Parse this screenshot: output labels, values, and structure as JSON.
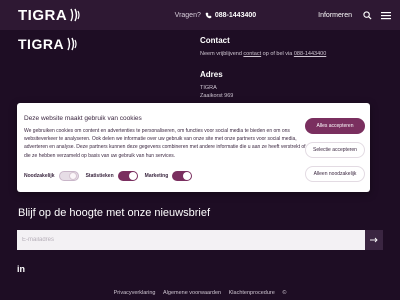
{
  "header": {
    "logo": "TIGRA",
    "question": "Vragen?",
    "phone": "088-1443400",
    "info": "Informeren",
    "search_icon": "search-icon",
    "menu_icon": "menu-icon"
  },
  "footer_logo": "TIGRA",
  "contact": {
    "title": "Contact",
    "text_before": "Neem vrijblijvend ",
    "link_contact": "contact",
    "text_middle": " op of bel via ",
    "link_phone": "088-1443400"
  },
  "adres": {
    "title": "Adres",
    "line1": "TIGRA",
    "line2": "Zaaikorst 969"
  },
  "cookie": {
    "title": "Deze website maakt gebruik van cookies",
    "body": "We gebruiken cookies om content en advertenties te personaliseren, om functies voor social media te bieden en om ons websiteverkeer te analyseren. Ook delen we informatie over uw gebruik van onze site met onze partners voor social media, adverteren en analyse. Deze partners kunnen deze gegevens combineren met andere informatie die u aan ze heeft verstrekt of die ze hebben verzameld op basis van uw gebruik van hun services.",
    "toggles": [
      {
        "label": "Noodzakelijk",
        "state": "on-disabled"
      },
      {
        "label": "Statistieken",
        "state": "on"
      },
      {
        "label": "Marketing",
        "state": "on"
      }
    ],
    "buttons": {
      "accept_all": "Alles accepteren",
      "accept_selection": "Selectie accepteren",
      "only_necessary": "Alleen noodzakelijk"
    }
  },
  "newsletter": {
    "title": "Blijf op de hoogte met onze nieuwsbrief",
    "placeholder": "E-mailadres"
  },
  "social": {
    "linkedin": "in"
  },
  "footer": {
    "links": [
      "Privacyverklaring",
      "Algemene voorwaarden",
      "Klachtenprocedure",
      "©"
    ]
  },
  "colors": {
    "background": "#1e0d24",
    "header": "#2e1833",
    "accent": "#7a2f5f"
  }
}
